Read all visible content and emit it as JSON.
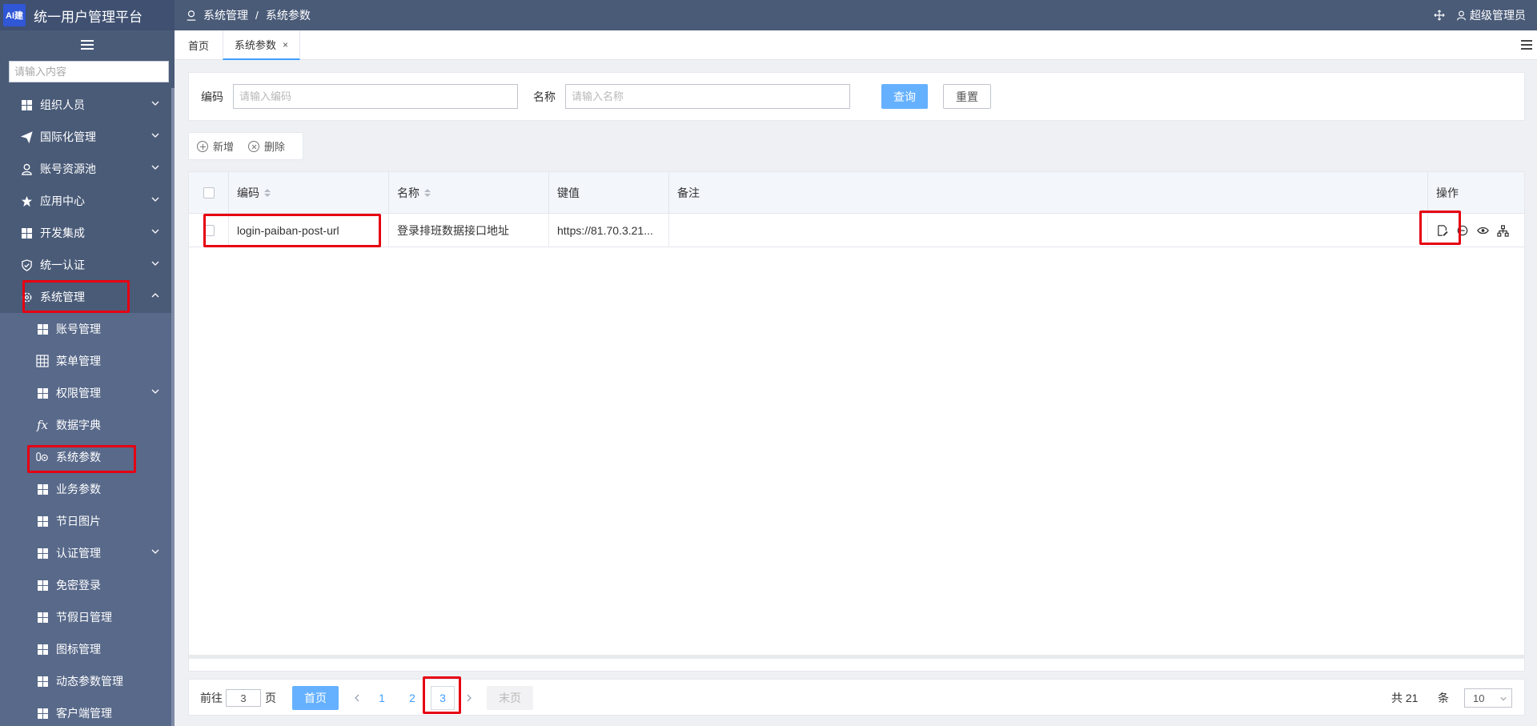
{
  "app": {
    "logo_text": "AI建",
    "title": "统一用户管理平台"
  },
  "sidebar": {
    "search_placeholder": "请输入内容",
    "items": [
      {
        "label": "组织人员",
        "icon": "grid-icon"
      },
      {
        "label": "国际化管理",
        "icon": "paper-plane-icon"
      },
      {
        "label": "账号资源池",
        "icon": "user-icon"
      },
      {
        "label": "应用中心",
        "icon": "star-icon"
      },
      {
        "label": "开发集成",
        "icon": "grid-icon"
      },
      {
        "label": "统一认证",
        "icon": "shield-icon"
      },
      {
        "label": "系统管理",
        "icon": "cog-icon"
      }
    ],
    "sub_items": [
      {
        "label": "账号管理",
        "icon": "grid-icon"
      },
      {
        "label": "菜单管理",
        "icon": "table-icon"
      },
      {
        "label": "权限管理",
        "icon": "grid-icon"
      },
      {
        "label": "数据字典",
        "icon": "fx-icon"
      },
      {
        "label": "系统参数",
        "icon": "params-icon"
      },
      {
        "label": "业务参数",
        "icon": "grid-icon"
      },
      {
        "label": "节日图片",
        "icon": "grid-icon"
      },
      {
        "label": "认证管理",
        "icon": "grid-icon"
      },
      {
        "label": "免密登录",
        "icon": "grid-icon"
      },
      {
        "label": "节假日管理",
        "icon": "grid-icon"
      },
      {
        "label": "图标管理",
        "icon": "grid-icon"
      },
      {
        "label": "动态参数管理",
        "icon": "grid-icon"
      },
      {
        "label": "客户端管理",
        "icon": "grid-icon"
      }
    ]
  },
  "header": {
    "breadcrumb": [
      "系统管理",
      "系统参数"
    ],
    "breadcrumb_sep": "/",
    "user_label": "超级管理员"
  },
  "tabs": [
    {
      "label": "首页"
    },
    {
      "label": "系统参数",
      "close": "×"
    }
  ],
  "search": {
    "code_label": "编码",
    "code_placeholder": "请输入编码",
    "name_label": "名称",
    "name_placeholder": "请输入名称",
    "query_label": "查询",
    "reset_label": "重置"
  },
  "toolbar": {
    "add_label": "新增",
    "delete_label": "删除"
  },
  "table": {
    "columns": [
      "编码",
      "名称",
      "键值",
      "备注",
      "操作"
    ],
    "rows": [
      {
        "code": "login-paiban-post-url",
        "name": "登录排班数据接口地址",
        "value": "https://81.70.3.21...",
        "remark": ""
      }
    ]
  },
  "pagination": {
    "goto_prefix": "前往",
    "goto_value": "3",
    "goto_suffix": "页",
    "first_label": "首页",
    "pages": [
      "1",
      "2",
      "3"
    ],
    "current_page": "3",
    "last_label": "末页",
    "total_label": "共 21",
    "unit_label": "条",
    "page_size": "10"
  },
  "colors": {
    "sidebar_bg": "#4a5b78",
    "primary": "#66b1ff",
    "link": "#409eff",
    "annotation_red": "#e60012"
  }
}
